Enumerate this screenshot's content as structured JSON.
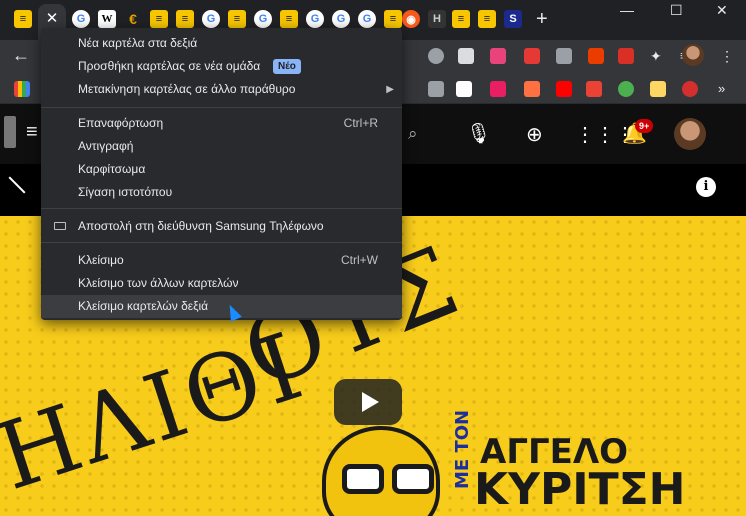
{
  "tabs": {
    "favicons": [
      {
        "name": "yellow-app-favicon",
        "glyph": "≡"
      },
      {
        "name": "close-tab-icon",
        "glyph": "✕"
      },
      {
        "name": "google-favicon",
        "glyph": "G"
      },
      {
        "name": "wikipedia-favicon",
        "glyph": "W"
      },
      {
        "name": "euro-favicon",
        "glyph": "€"
      },
      {
        "name": "yellow-app-favicon",
        "glyph": "≡"
      },
      {
        "name": "yellow-app-favicon",
        "glyph": "≡"
      },
      {
        "name": "google-favicon",
        "glyph": "G"
      },
      {
        "name": "yellow-app-favicon",
        "glyph": "≡"
      },
      {
        "name": "google-favicon",
        "glyph": "G"
      },
      {
        "name": "yellow-app-favicon",
        "glyph": "≡"
      },
      {
        "name": "google-favicon",
        "glyph": "G"
      },
      {
        "name": "google-favicon",
        "glyph": "G"
      },
      {
        "name": "google-favicon",
        "glyph": "G"
      },
      {
        "name": "yellow-app-favicon",
        "glyph": "≡"
      },
      {
        "name": "firefox-favicon",
        "glyph": "◉"
      },
      {
        "name": "h-favicon",
        "glyph": "H"
      },
      {
        "name": "yellow-app-favicon",
        "glyph": "≡"
      },
      {
        "name": "yellow-app-favicon",
        "glyph": "≡"
      },
      {
        "name": "s-favicon",
        "glyph": "S"
      }
    ],
    "new_tab": "+",
    "minimize": "—",
    "maximize": "☐",
    "close": "✕"
  },
  "context_menu": {
    "new_tab_right": "Νέα καρτέλα στα δεξιά",
    "add_to_group": "Προσθήκη καρτέλας σε νέα ομάδα",
    "new_badge": "Νέο",
    "move_to_window": "Μετακίνηση καρτέλας σε άλλο παράθυρο",
    "reload": "Επαναφόρτωση",
    "reload_shortcut": "Ctrl+R",
    "duplicate": "Αντιγραφή",
    "pin": "Καρφίτσωμα",
    "mute_site": "Σίγαση ιστοτόπου",
    "send_to_device": "Αποστολή στη διεύθυνση Samsung Τηλέφωνο",
    "close": "Κλείσιμο",
    "close_shortcut": "Ctrl+W",
    "close_others": "Κλείσιμο των άλλων καρτελών",
    "close_right": "Κλείσιμο καρτελών δεξιά"
  },
  "video": {
    "cover_text_1": "ΗΛΙΘΙ",
    "cover_text_2": "ΟΥΣ",
    "cover_text_me_ton": "ΜΕ ΤΟΝ",
    "cover_text_angelo": "ΑΓΓΕΛΟ",
    "cover_text_kyritsi": "ΚΥΡΙΤΣΗ",
    "info": "i"
  },
  "header": {
    "notifications_count": "9+"
  },
  "colors": {
    "accent_yellow": "#f8cc1b",
    "menu_bg": "#292a2d",
    "badge_blue": "#8ab4f8",
    "notification_red": "#cc0000"
  }
}
